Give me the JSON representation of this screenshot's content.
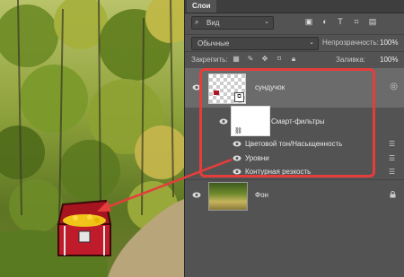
{
  "panel": {
    "tab_label": "Слои",
    "filter_kind": "Вид",
    "blend_mode": "Обычные",
    "opacity_label": "Непрозрачность:",
    "opacity_value": "100%",
    "lock_label": "Закрепить:",
    "fill_label": "Заливка:",
    "fill_value": "100%"
  },
  "layers": {
    "main_name": "сундучок",
    "smart_filters_label": "Смарт-фильтры",
    "filters": [
      "Цветовой тон/Насыщенность",
      "Уровни",
      "Контурная резкость"
    ],
    "bg_name": "Фон"
  },
  "colors": {
    "highlight": "#e53d3b",
    "panel_bg": "#535353",
    "selected_layer": "#6b6b6b"
  }
}
